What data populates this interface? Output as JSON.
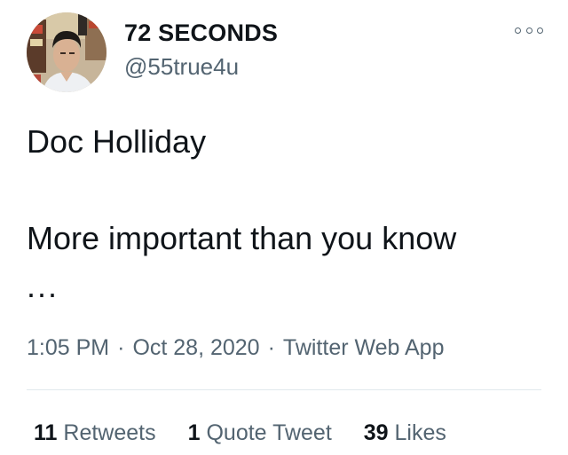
{
  "user": {
    "display_name": "72 SECONDS",
    "handle": "@55true4u",
    "avatar_icon": "profile-photo"
  },
  "tweet": {
    "line1": "Doc Holliday",
    "line2": "More important than you know",
    "line3": "..."
  },
  "meta": {
    "time": "1:05 PM",
    "separator": "·",
    "date": "Oct 28, 2020",
    "source": "Twitter Web App"
  },
  "stats": {
    "retweets_count": "11",
    "retweets_label": "Retweets",
    "quotes_count": "1",
    "quotes_label": "Quote Tweet",
    "likes_count": "39",
    "likes_label": "Likes"
  },
  "menu": {
    "more_icon": "more-options-icon"
  },
  "colors": {
    "text": "#0f1419",
    "secondary": "#536471",
    "divider": "#e1e8ed"
  }
}
